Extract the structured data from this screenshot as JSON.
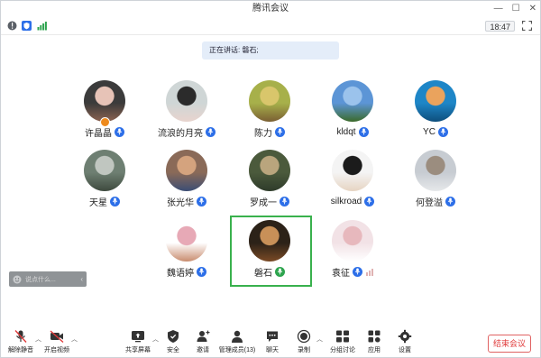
{
  "window": {
    "title": "腾讯会议",
    "clock": "18:47"
  },
  "banner": {
    "speaking_label": "正在讲话: 磐石;"
  },
  "participants": [
    {
      "name": "许晶晶",
      "mic": "blue",
      "host": true,
      "avatar_colors": [
        "#3b3b3b",
        "#e7c3b7",
        "#8b6250"
      ]
    },
    {
      "name": "流浪的月亮",
      "mic": "blue",
      "host": false,
      "avatar_colors": [
        "#cfd6d6",
        "#2b2b2b",
        "#e8d4ce"
      ]
    },
    {
      "name": "陈力",
      "mic": "blue",
      "host": false,
      "avatar_colors": [
        "#a7b04a",
        "#d9c66b",
        "#7a5f33"
      ]
    },
    {
      "name": "kldqt",
      "mic": "blue",
      "host": false,
      "avatar_colors": [
        "#5c95d6",
        "#9bc3ec",
        "#3b6a2a"
      ]
    },
    {
      "name": "YC",
      "mic": "blue",
      "host": false,
      "avatar_colors": [
        "#1e86c7",
        "#eaa35d",
        "#0e4e7c"
      ]
    },
    {
      "name": "天星",
      "mic": "blue",
      "host": false,
      "avatar_colors": [
        "#6e7f72",
        "#c0c6c0",
        "#3e4a3e"
      ]
    },
    {
      "name": "张光华",
      "mic": "blue",
      "host": false,
      "avatar_colors": [
        "#8a6a58",
        "#d4a37e",
        "#3b4d74"
      ]
    },
    {
      "name": "罗成一",
      "mic": "blue",
      "host": false,
      "avatar_colors": [
        "#4b5a3c",
        "#b9a57d",
        "#2e3b2a"
      ]
    },
    {
      "name": "silkroad",
      "mic": "blue",
      "host": false,
      "avatar_colors": [
        "#f4f4f4",
        "#1b1b1b",
        "#e6d4c2"
      ]
    },
    {
      "name": "何登溢",
      "mic": "blue",
      "host": false,
      "avatar_colors": [
        "#c7ccd2",
        "#9b8d7f",
        "#e6e8ea"
      ]
    },
    {
      "name": "魏语婷",
      "mic": "blue",
      "host": false,
      "avatar_colors": [
        "#ffffff",
        "#e7a9b6",
        "#c88c6e"
      ]
    },
    {
      "name": "磐石",
      "mic": "green",
      "host": false,
      "avatar_colors": [
        "#2c2218",
        "#c89058",
        "#7a4a25"
      ]
    },
    {
      "name": "袁征",
      "mic": "blue",
      "host": false,
      "avatar_colors": [
        "#f2e2e6",
        "#e7b8bd",
        "#ffffff"
      ]
    }
  ],
  "chat": {
    "placeholder": "说点什么..."
  },
  "toolbar": {
    "mute": "解除静音",
    "video": "开启视频",
    "share": "共享屏幕",
    "security": "安全",
    "invite": "邀请",
    "members": "管理成员(13)",
    "chat": "聊天",
    "record": "录制",
    "breakout": "分组讨论",
    "apps": "应用",
    "settings": "设置",
    "end": "结束会议"
  },
  "colors": {
    "accent": "#2d6fe8",
    "speaking_highlight": "#39b14d",
    "end": "#e03b3b"
  }
}
